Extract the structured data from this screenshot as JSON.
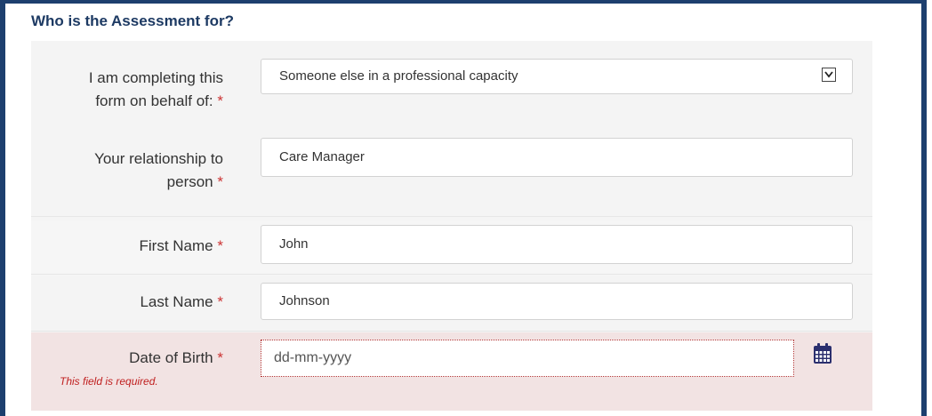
{
  "section": {
    "title": "Who is the Assessment for?"
  },
  "fields": {
    "behalf": {
      "label_line1": "I am completing this",
      "label_line2": "form on behalf of:",
      "required": "*",
      "value": "Someone else in a professional capacity"
    },
    "relationship": {
      "label_line1": "Your relationship to",
      "label_line2": "person",
      "required": "*",
      "value": "Care Manager"
    },
    "first_name": {
      "label": "First Name",
      "required": "*",
      "value": "John"
    },
    "last_name": {
      "label": "Last Name",
      "required": "*",
      "value": "Johnson"
    },
    "dob": {
      "label": "Date of Birth",
      "required": "*",
      "placeholder": "dd-mm-yyyy",
      "error": "This field is required."
    }
  },
  "icons": {
    "dropdown": "chevron-down-icon",
    "calendar": "calendar-icon"
  },
  "colors": {
    "header": "#1d3a63",
    "required": "#cc3333",
    "error_bg": "#f2e3e3",
    "calendar": "#2b2f6e"
  }
}
